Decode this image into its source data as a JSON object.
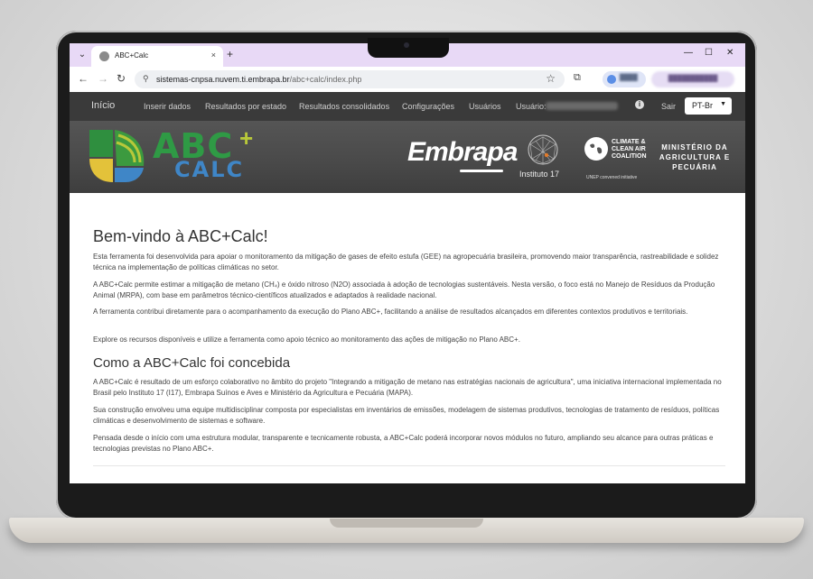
{
  "browser": {
    "tab_title": "ABC+Calc",
    "tab_close": "×",
    "new_tab": "+",
    "url_host": "sistemas-cnpsa.nuvem.ti.embrapa.br",
    "url_path": "/abc+calc/index.php"
  },
  "navbar": {
    "brand": "Início",
    "items": [
      "Inserir dados",
      "Resultados por estado",
      "Resultados consolidados",
      "Configurações",
      "Usuários"
    ],
    "user_label": "Usuário:",
    "info": "i",
    "logout": "Sair",
    "language": "PT-Br"
  },
  "banner": {
    "abc": "ABC",
    "plus": "+",
    "calc": "CALC",
    "embrapa": "Embrapa",
    "instituto": "Instituto 17",
    "ccac_lines": [
      "CLIMATE &",
      "CLEAN AIR",
      "COALITION"
    ],
    "ccac_sub": "UNEP convened initiative",
    "ministerio_lines": [
      "MINISTÉRIO DA",
      "AGRICULTURA E",
      "PECUÁRIA"
    ]
  },
  "content": {
    "title": "Bem-vindo à ABC+Calc!",
    "intro": [
      "Esta ferramenta foi desenvolvida para apoiar o monitoramento da mitigação de gases de efeito estufa (GEE) na agropecuária brasileira, promovendo maior transparência, rastreabilidade e solidez técnica na implementação de políticas climáticas no setor.",
      "A ABC+Calc permite estimar a mitigação de metano (CH₄) e óxido nitroso (N2O) associada à adoção de tecnologias sustentáveis. Nesta versão, o foco está no Manejo de Resíduos da Produção Animal (MRPA), com base em parâmetros técnico-científicos atualizados e adaptados à realidade nacional.",
      "A ferramenta contribui diretamente para o acompanhamento da execução do Plano ABC+, facilitando a análise de resultados alcançados em diferentes contextos produtivos e territoriais.",
      "Explore os recursos disponíveis e utilize a ferramenta como apoio técnico ao monitoramento das ações de mitigação no Plano ABC+."
    ],
    "subtitle": "Como a ABC+Calc foi concebida",
    "about": [
      "A ABC+Calc é resultado de um esforço colaborativo no âmbito do projeto \"Integrando a mitigação de metano nas estratégias nacionais de agricultura\", uma iniciativa internacional implementada no Brasil pelo Instituto 17 (I17), Embrapa Suínos e Aves e Ministério da Agricultura e Pecuária (MAPA).",
      "Sua construção envolveu uma equipe multidisciplinar composta por especialistas em inventários de emissões, modelagem de sistemas produtivos, tecnologias de tratamento de resíduos, políticas climáticas e desenvolvimento de sistemas e software.",
      "Pensada desde o início com uma estrutura modular, transparente e tecnicamente robusta, a ABC+Calc poderá incorporar novos módulos no futuro, ampliando seu alcance para outras práticas e tecnologias previstas no Plano ABC+."
    ]
  }
}
